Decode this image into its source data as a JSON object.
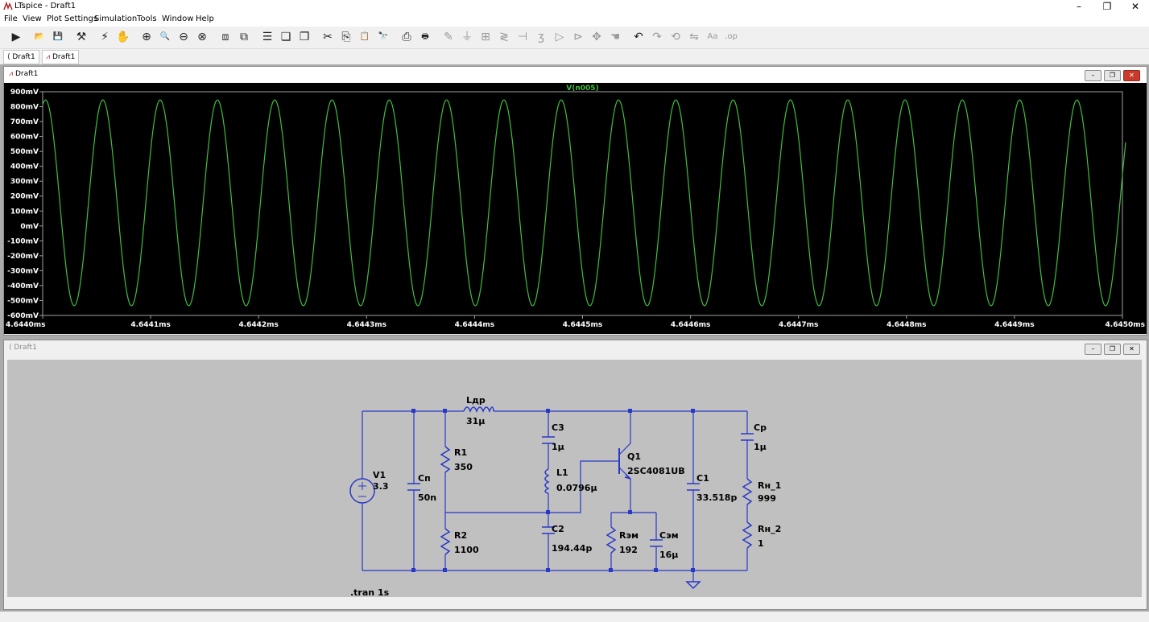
{
  "app": {
    "title": "LTspice - Draft1"
  },
  "menu": [
    "File",
    "View",
    "Plot Settings",
    "Simulation",
    "Tools",
    "Window",
    "Help"
  ],
  "window_controls": {
    "minimize": "–",
    "restore": "❐",
    "close": "✕"
  },
  "toolbar": [
    {
      "icon": "run-icon",
      "glyph": "▶"
    },
    {
      "icon": "open-icon",
      "glyph": "📂"
    },
    {
      "icon": "save-icon",
      "glyph": "💾"
    },
    {
      "icon": "control-panel-icon",
      "glyph": "⚒"
    },
    {
      "icon": "autorange-icon",
      "glyph": "⚡"
    },
    {
      "icon": "pan-icon",
      "glyph": "✋"
    },
    {
      "icon": "zoom-in-icon",
      "glyph": "⊕"
    },
    {
      "icon": "zoom-area-icon",
      "glyph": "🔍"
    },
    {
      "icon": "zoom-out-icon",
      "glyph": "⊖"
    },
    {
      "icon": "zoom-cancel-icon",
      "glyph": "⊗"
    },
    {
      "icon": "autorange-y-icon",
      "glyph": "⧈"
    },
    {
      "icon": "autorange-x-icon",
      "glyph": "⧉"
    },
    {
      "icon": "tile-horizontal-icon",
      "glyph": "☰"
    },
    {
      "icon": "cascade-icon",
      "glyph": "❏"
    },
    {
      "icon": "tile-vertical-icon",
      "glyph": "❐"
    },
    {
      "icon": "cut-icon",
      "glyph": "✂"
    },
    {
      "icon": "copy-icon",
      "glyph": "⎘"
    },
    {
      "icon": "paste-icon",
      "glyph": "📋"
    },
    {
      "icon": "find-icon",
      "glyph": "🔭"
    },
    {
      "icon": "print-icon",
      "glyph": "⎙"
    },
    {
      "icon": "print-setup-icon",
      "glyph": "🖶"
    },
    {
      "icon": "wire-icon",
      "glyph": "✎",
      "disabled": true
    },
    {
      "icon": "ground-icon",
      "glyph": "⏚",
      "disabled": true
    },
    {
      "icon": "label-icon",
      "glyph": "⊞",
      "disabled": true
    },
    {
      "icon": "resistor-icon",
      "glyph": "≷",
      "disabled": true
    },
    {
      "icon": "capacitor-icon",
      "glyph": "⊣",
      "disabled": true
    },
    {
      "icon": "inductor-icon",
      "glyph": "ʒ",
      "disabled": true
    },
    {
      "icon": "diode-icon",
      "glyph": "▷",
      "disabled": true
    },
    {
      "icon": "component-icon",
      "glyph": "⊳",
      "disabled": true
    },
    {
      "icon": "move-icon",
      "glyph": "✥",
      "disabled": true
    },
    {
      "icon": "drag-icon",
      "glyph": "☚",
      "disabled": true
    },
    {
      "icon": "undo-icon",
      "glyph": "↶"
    },
    {
      "icon": "redo-icon",
      "glyph": "↷",
      "disabled": true
    },
    {
      "icon": "rotate-icon",
      "glyph": "⟲",
      "disabled": true
    },
    {
      "icon": "mirror-icon",
      "glyph": "⇋",
      "disabled": true
    },
    {
      "icon": "text-icon",
      "glyph": "Aa",
      "disabled": true
    },
    {
      "icon": "spice-directive-icon",
      "glyph": ".op",
      "disabled": true
    }
  ],
  "tabs": [
    "Draft1",
    "Draft1"
  ],
  "plot_window": {
    "title": "Draft1"
  },
  "schematic_window": {
    "title": "Draft1"
  },
  "chart_data": {
    "type": "line",
    "series": [
      {
        "name": "V(n005)",
        "color": "#3fbf3f"
      }
    ],
    "xlabel": "",
    "ylabel": "",
    "x_ticks": [
      "4.6440ms",
      "4.6441ms",
      "4.6442ms",
      "4.6443ms",
      "4.6444ms",
      "4.6445ms",
      "4.6446ms",
      "4.6447ms",
      "4.6448ms",
      "4.6449ms",
      "4.6450ms"
    ],
    "y_ticks": [
      "900mV",
      "800mV",
      "700mV",
      "600mV",
      "500mV",
      "400mV",
      "300mV",
      "200mV",
      "100mV",
      "0mV",
      "-100mV",
      "-200mV",
      "-300mV",
      "-400mV",
      "-500mV",
      "-600mV"
    ],
    "xlim": [
      4.644,
      4.645
    ],
    "ylim": [
      -600,
      900
    ],
    "cycles": 18.9,
    "peak_mv": 845,
    "trough_mv": -535,
    "phase_start_deg": 72,
    "grid": false,
    "background": "#000000",
    "axis_color": "#a0a0a0"
  },
  "schematic": {
    "wire_color": "#2838c8",
    "labels": {
      "L_dr_name": "Lдр",
      "L_dr_val": "31μ",
      "C3_name": "C3",
      "C3_val": "1μ",
      "Q1_name": "Q1",
      "Q1_val": "2SC4081UB",
      "Cp_name": "Cp",
      "Cp_val": "1μ",
      "R1_name": "R1",
      "R1_val": "350",
      "L1_name": "L1",
      "L1_val": "0.0796μ",
      "V1_name": "V1",
      "V1_val": "3.3",
      "Cn_name": "Cп",
      "Cn_val": "50n",
      "C1_name": "C1",
      "C1_val": "33.518p",
      "Rn1_name": "Rн_1",
      "Rn1_val": "999",
      "R2_name": "R2",
      "R2_val": "1100",
      "C2_name": "C2",
      "C2_val": "194.44p",
      "Rem_name": "Rэм",
      "Rem_val": "192",
      "Cem_name": "Cэм",
      "Cem_val": "16μ",
      "Rn2_name": "Rн_2",
      "Rn2_val": "1",
      "directive": ".tran 1s"
    }
  }
}
